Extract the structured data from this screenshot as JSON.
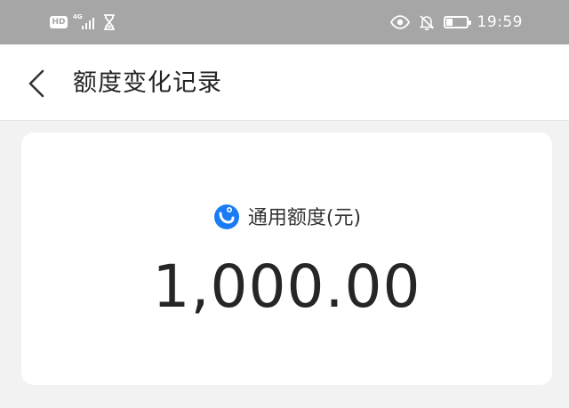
{
  "status_bar": {
    "hd_badge": "HD",
    "network": "4G",
    "time": "19:59",
    "battery_level": 0.35,
    "icons": [
      "hd-icon",
      "signal-icon",
      "hourglass-icon",
      "eye-icon",
      "bell-off-icon",
      "battery-icon"
    ]
  },
  "header": {
    "title": "额度变化记录",
    "back_icon": "chevron-left-icon"
  },
  "quota_card": {
    "label": "通用额度(元)",
    "amount": "1,000.00",
    "logo_icon": "brand-logo-icon",
    "brand_color": "#1a7cf5"
  }
}
